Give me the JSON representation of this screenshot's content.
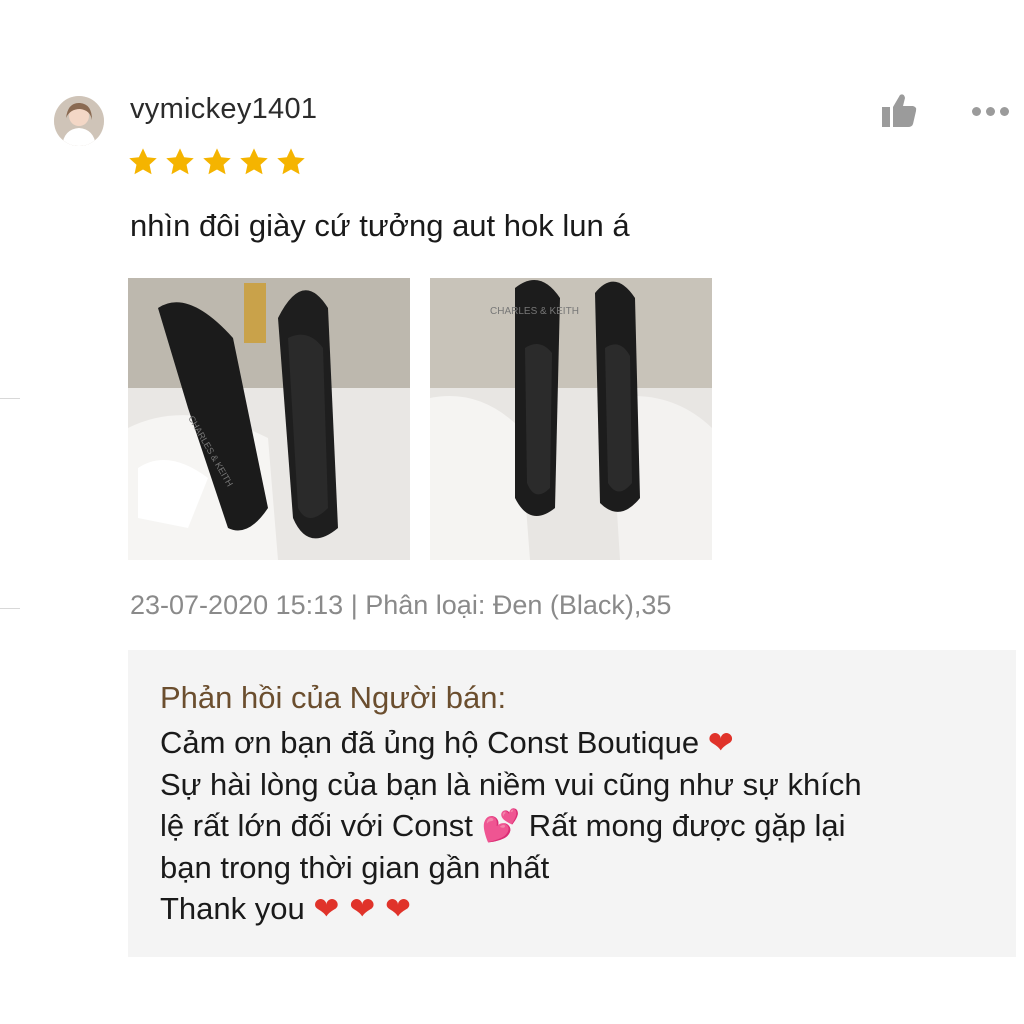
{
  "review": {
    "username": "vymickey1401",
    "rating": 5,
    "text": "nhìn đôi giày cứ tưởng aut hok lun á",
    "photos": [
      {
        "label": "CHARLES & KEITH"
      },
      {
        "label": "CHARLES & KEITH"
      }
    ],
    "date": "23-07-2020 15:13",
    "separator": "|",
    "variant_label": "Phân loại:",
    "variant_value": "Đen (Black),35"
  },
  "seller_reply": {
    "title": "Phản hồi của Người bán:",
    "line1_text": "Cảm ơn bạn đã ủng hộ Const Boutique",
    "line1_emoji": "❤",
    "line2_text": "Sự hài lòng của bạn là niềm vui cũng như sự khích",
    "line3_text_a": "lệ rất lớn đối với Const",
    "line3_emoji": "💕",
    "line3_text_b": "Rất mong được gặp lại",
    "line4_text": "bạn trong thời gian gần nhất",
    "line5_text": "Thank you",
    "line5_emoji": "❤ ❤ ❤"
  },
  "icons": {
    "like": "thumbs-up-icon",
    "more": "more-dots-icon",
    "star": "star-icon"
  },
  "colors": {
    "star": "#f5b400",
    "reply_title": "#6b4e2e",
    "heart": "#e0332a"
  }
}
